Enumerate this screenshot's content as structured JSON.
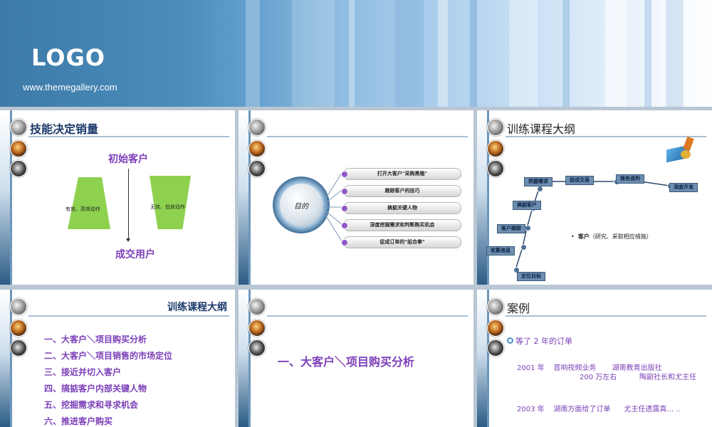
{
  "header": {
    "logo": "LOGO",
    "url": "www.themegallery.com"
  },
  "slides": {
    "s1": {
      "title": "技能决定销量",
      "top_label": "初始客户",
      "bottom_label": "成交用户",
      "left_box": "有效、高效动作",
      "right_box": "无效、低效动作"
    },
    "s2": {
      "center": "目的",
      "items": [
        "打开大客户\"采购黑箱\"",
        "跟踪客户的技巧",
        "搞掂关键人物",
        "深度挖掘需求和判断购买机会",
        "促成订单的\"组合拳\""
      ]
    },
    "s3": {
      "title": "训练课程大纲",
      "steps": [
        "定位目标",
        "收集信息",
        "客户跟踪",
        "搞掂客户",
        "把握需求",
        "促成交易",
        "商务谈判",
        "深度开发"
      ],
      "bullet_bold": "客户",
      "bullet_rest": "（研究、采取相应措施）"
    },
    "s4": {
      "title": "训练课程大纲",
      "items": [
        "一、大客户＼项目购买分析",
        "二、大客户＼项目销售的市场定位",
        "三、接近并切入客户",
        "四、搞掂客户内部关键人物",
        "五、挖掘需求和寻求机会",
        "六、推进客户购买"
      ]
    },
    "s5": {
      "heading": "一、大客户＼项目购买分析"
    },
    "s6": {
      "title": "案例",
      "bullet": "等了 2 年的订单",
      "line1": "2001 年    音响视频业务       湖南教育出版社",
      "line2": "200 万左右          陶副社长和尤主任",
      "line3": "2003 年    湖南方面给了订单      尤主任透露真… .."
    }
  },
  "colors": {
    "accent_purple": "#7b3fb8",
    "navy": "#1d3a6b",
    "green": "#8ed14f"
  }
}
